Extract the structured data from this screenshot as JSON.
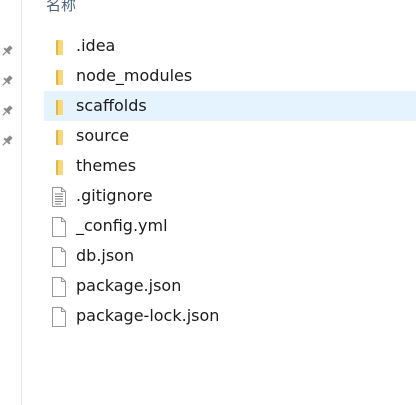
{
  "header": {
    "name_column": "名称"
  },
  "quick_access": {
    "pins": [
      "pin-icon",
      "pin-icon",
      "pin-icon",
      "pin-icon"
    ]
  },
  "colors": {
    "folder": "#f8d775",
    "folder_dark": "#e0b64a",
    "selection": "#e5f3ff",
    "header_text": "#4c607a"
  },
  "files": [
    {
      "name": ".idea",
      "type": "folder"
    },
    {
      "name": "node_modules",
      "type": "folder"
    },
    {
      "name": "scaffolds",
      "type": "folder",
      "selected": true
    },
    {
      "name": "source",
      "type": "folder"
    },
    {
      "name": "themes",
      "type": "folder"
    },
    {
      "name": ".gitignore",
      "type": "text-file"
    },
    {
      "name": "_config.yml",
      "type": "file"
    },
    {
      "name": "db.json",
      "type": "file"
    },
    {
      "name": "package.json",
      "type": "file"
    },
    {
      "name": "package-lock.json",
      "type": "file"
    }
  ]
}
